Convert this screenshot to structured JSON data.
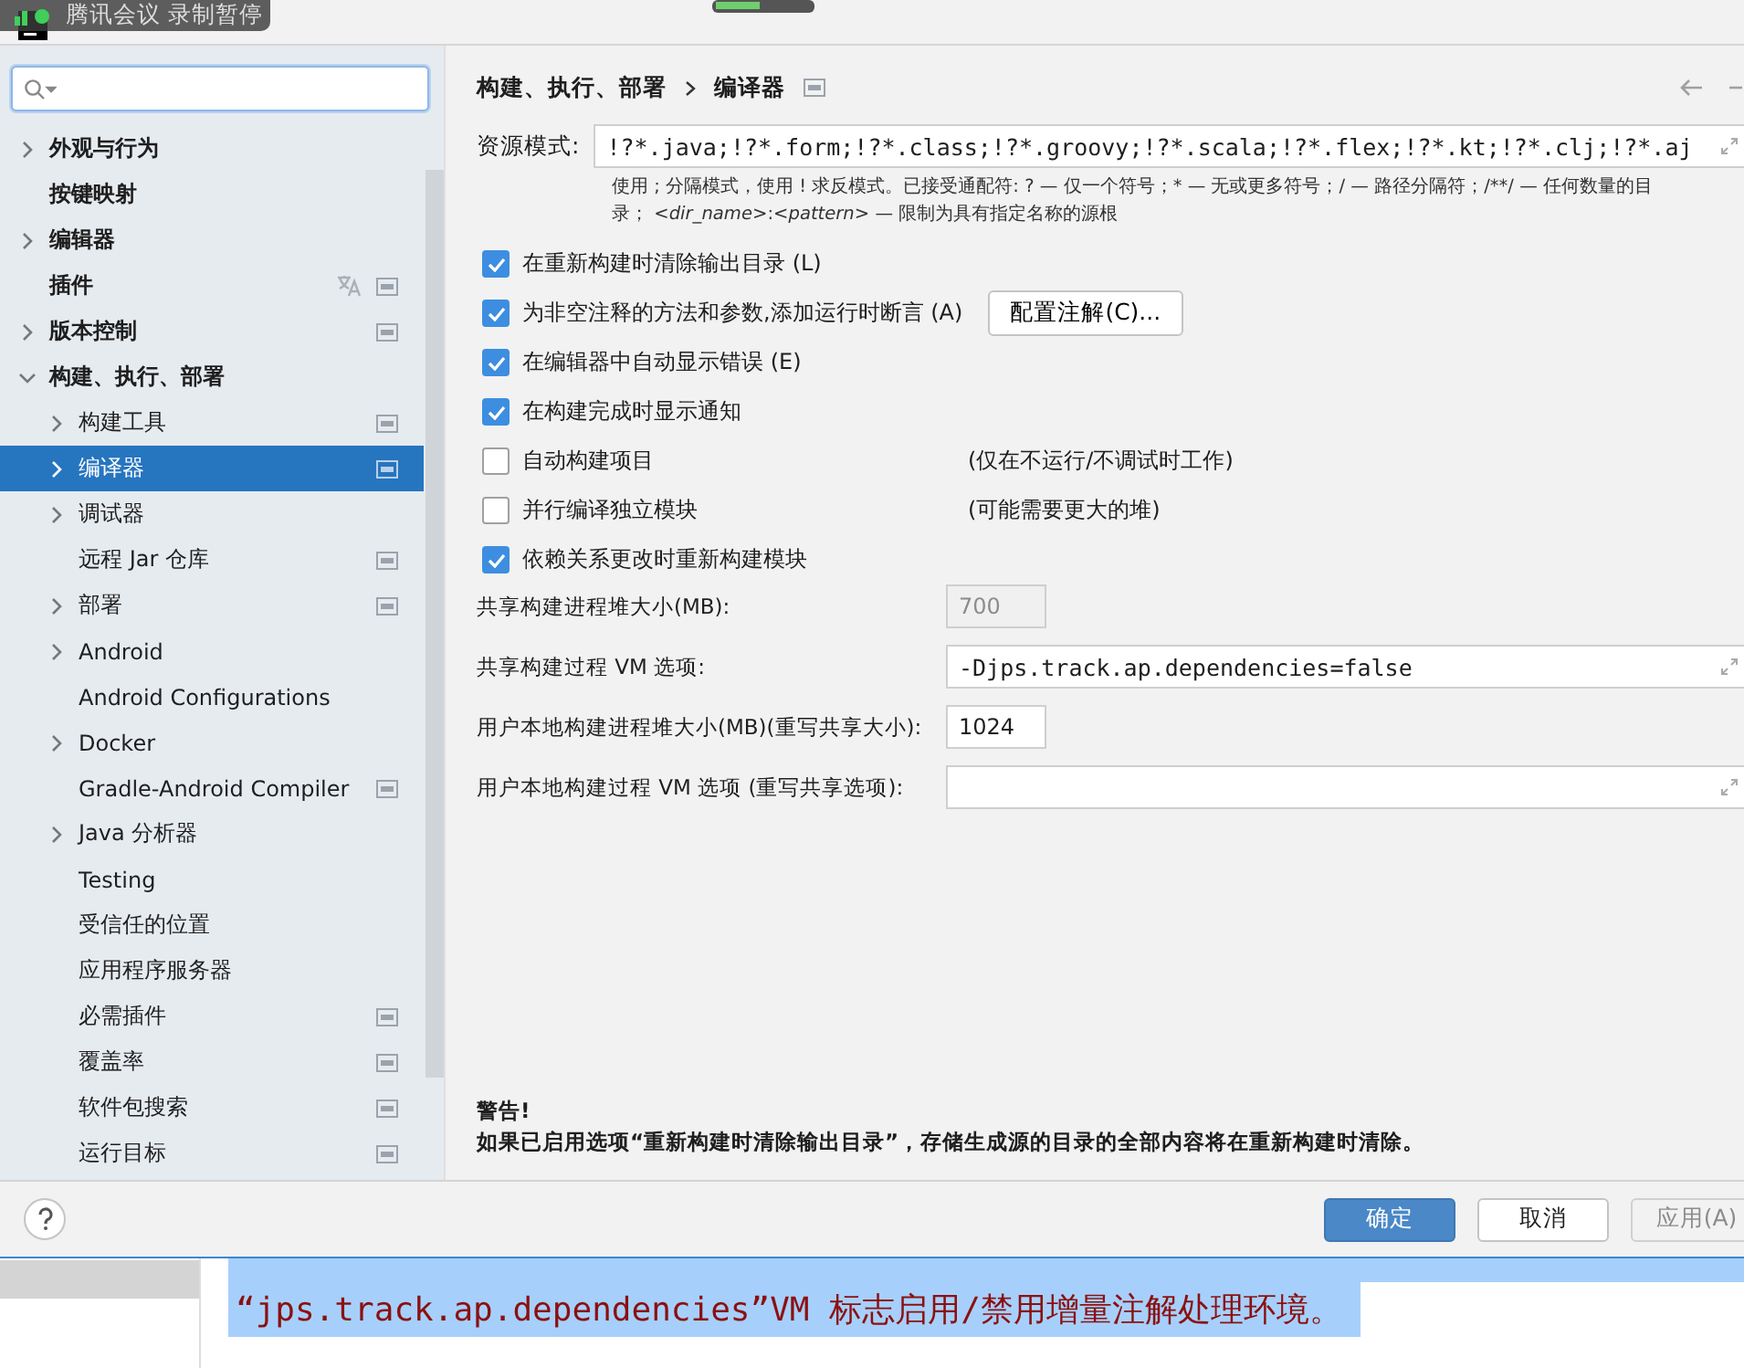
{
  "overlay": {
    "text": "腾讯会议  录制暂停"
  },
  "tree": [
    {
      "label": "外观与行为",
      "expanded": false,
      "bold": true
    },
    {
      "label": "按键映射",
      "bold": true
    },
    {
      "label": "编辑器",
      "expanded": false,
      "bold": true
    },
    {
      "label": "插件",
      "bold": true,
      "translatable": true,
      "project_scoped": true
    },
    {
      "label": "版本控制",
      "expanded": false,
      "bold": true,
      "project_scoped": true
    },
    {
      "label": "构建、执行、部署",
      "expanded": true,
      "bold": true,
      "children": [
        {
          "label": "构建工具",
          "expanded": false,
          "project_scoped": true
        },
        {
          "label": "编译器",
          "expanded": false,
          "selected": true,
          "project_scoped": true
        },
        {
          "label": "调试器",
          "expanded": false
        },
        {
          "label": "远程 Jar 仓库",
          "project_scoped": true
        },
        {
          "label": "部署",
          "expanded": false,
          "project_scoped": true
        },
        {
          "label": "Android",
          "expanded": false
        },
        {
          "label": "Android Configurations"
        },
        {
          "label": "Docker",
          "expanded": false
        },
        {
          "label": "Gradle-Android Compiler",
          "project_scoped": true
        },
        {
          "label": "Java 分析器",
          "expanded": false
        },
        {
          "label": "Testing"
        },
        {
          "label": "受信任的位置"
        },
        {
          "label": "应用程序服务器"
        },
        {
          "label": "必需插件",
          "project_scoped": true
        },
        {
          "label": "覆盖率",
          "project_scoped": true
        },
        {
          "label": "软件包搜索",
          "project_scoped": true
        },
        {
          "label": "运行目标",
          "project_scoped": true
        }
      ]
    }
  ],
  "breadcrumb": [
    "构建、执行、部署",
    "编译器"
  ],
  "resource_patterns": {
    "label": "资源模式:",
    "value": "!?*.java;!?*.form;!?*.class;!?*.groovy;!?*.scala;!?*.flex;!?*.kt;!?*.clj;!?*.aj"
  },
  "hint": [
    "使用 ; 分隔模式，使用 ! 求反模式。已接受通配符: ? — 仅一个符号；* — 无或更多符号；/ — 路径分隔符；/**/ — 任何数量的目",
    "录；  *<dir_name>*:*<pattern>* — 限制为具有指定名称的源根"
  ],
  "options": [
    {
      "label": "在重新构建时清除输出目录 (L)",
      "checked": true
    },
    {
      "label": "为非空注释的方法和参数,添加运行时断言 (A)",
      "checked": true,
      "button": "配置注解(C)..."
    },
    {
      "label": "在编辑器中自动显示错误 (E)",
      "checked": true
    },
    {
      "label": "在构建完成时显示通知",
      "checked": true
    },
    {
      "label": "自动构建项目",
      "checked": false,
      "note": "(仅在不运行/不调试时工作)"
    },
    {
      "label": "并行编译独立模块",
      "checked": false,
      "note": "(可能需要更大的堆)"
    },
    {
      "label": "依赖关系更改时重新构建模块",
      "checked": true
    }
  ],
  "fields": [
    {
      "label": "共享构建进程堆大小(MB):",
      "value": "700",
      "kind": "small",
      "disabled": true
    },
    {
      "label": "共享构建过程 VM 选项:",
      "value": "-Djps.track.ap.dependencies=false",
      "kind": "wide",
      "disabled": false
    },
    {
      "label": "用户本地构建进程堆大小(MB)(重写共享大小):",
      "value": "1024",
      "kind": "small",
      "disabled": false
    },
    {
      "label": "用户本地构建过程 VM 选项 (重写共享选项):",
      "kind": "wide",
      "disabled": false
    }
  ],
  "warning": {
    "title": "警告!",
    "text": "如果已启用选项“重新构建时清除输出目录”，存储生成源的目录的全部内容将在重新构建时清除。"
  },
  "buttons": [
    {
      "label": "确定",
      "kind": "primary",
      "disabled": false
    },
    {
      "label": "取消",
      "kind": "normal",
      "disabled": false
    },
    {
      "label": "应用(A)",
      "kind": "normal",
      "disabled": true
    }
  ],
  "editor": {
    "line": "“jps.track.ap.dependencies”VM 标志启用/禁用增量注解处理环境。"
  }
}
